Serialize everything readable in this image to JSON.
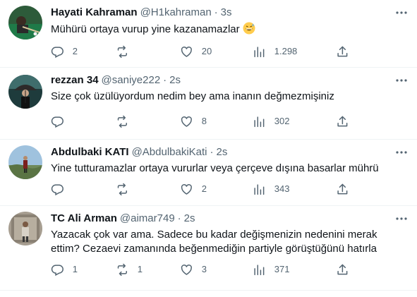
{
  "tweets": [
    {
      "name": "Hayati Kahraman",
      "handle": "@H1kahraman",
      "separator": "·",
      "time": "3s",
      "text": "Mühürü ortaya vurup yine kazanamazlar",
      "emoji": "grinning-sweat-emoji",
      "replies": "2",
      "retweets": "",
      "likes": "20",
      "views": "1.298"
    },
    {
      "name": "rezzan 34",
      "handle": "@saniye222",
      "separator": "·",
      "time": "2s",
      "text": "Size çok üzülüyordum nedim bey ama inanın değmezmişiniz",
      "replies": "",
      "retweets": "",
      "likes": "8",
      "views": "302"
    },
    {
      "name": "Abdulbaki KATI",
      "handle": "@AbdulbakiKati",
      "separator": "·",
      "time": "2s",
      "text": "Yine tutturamazlar ortaya vururlar veya çerçeve dışına basarlar mührü",
      "replies": "",
      "retweets": "",
      "likes": "2",
      "views": "343"
    },
    {
      "name": "TC Ali Arman",
      "handle": "@aimar749",
      "separator": "·",
      "time": "2s",
      "text": "Yazacak çok var ama. Sadece bu kadar değişmenizin nedenini merak ettim? Cezaevi zamanında beğenmediğin partiyle görüştüğünü hatırla",
      "replies": "1",
      "retweets": "1",
      "likes": "3",
      "views": "371"
    }
  ],
  "icons": {
    "reply": "reply-icon",
    "retweet": "retweet-icon",
    "like": "like-icon",
    "views": "views-icon",
    "share": "share-icon",
    "more": "more-icon"
  },
  "colors": {
    "text": "#0f1419",
    "secondary": "#536471",
    "divider": "#eff3f4"
  }
}
